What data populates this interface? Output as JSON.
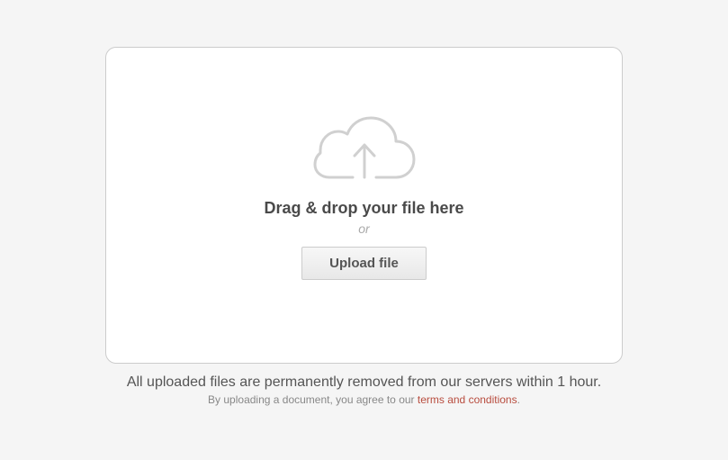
{
  "dropzone": {
    "heading": "Drag & drop your file here",
    "or": "or",
    "button_label": "Upload file"
  },
  "footer": {
    "notice": "All uploaded files are permanently removed from our servers within 1 hour.",
    "agree_prefix": "By uploading a document, you agree to our ",
    "terms_link_label": "terms and conditions",
    "agree_suffix": "."
  },
  "colors": {
    "page_bg": "#f5f5f5",
    "panel_bg": "#ffffff",
    "border": "#cccccc",
    "heading_text": "#4a4a4a",
    "muted_text": "#aaaaaa",
    "link": "#b84c3e"
  }
}
